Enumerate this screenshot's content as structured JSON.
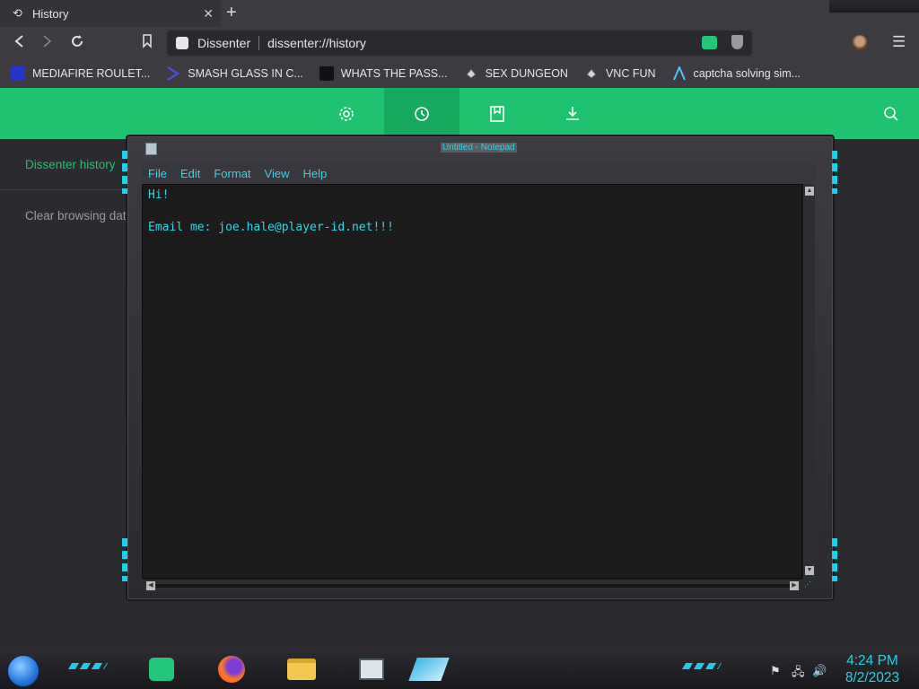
{
  "browser": {
    "tab": {
      "title": "History",
      "icon": "history-icon"
    },
    "address": {
      "site_name": "Dissenter",
      "url": "dissenter://history"
    },
    "bookmarks": [
      {
        "label": "MEDIAFIRE ROULET...",
        "icon": "mediafire-icon",
        "color": "#2336c9"
      },
      {
        "label": "SMASH GLASS IN C...",
        "icon": "chevron-icon",
        "color": "#4a4ed8"
      },
      {
        "label": "WHATS THE PASS...",
        "icon": "lock-icon",
        "color": "#111111"
      },
      {
        "label": "SEX DUNGEON",
        "icon": "pixel-icon",
        "color": "#cfcfcf"
      },
      {
        "label": "VNC FUN",
        "icon": "pixel-icon",
        "color": "#cfcfcf"
      },
      {
        "label": "captcha solving sim...",
        "icon": "a-logo-icon",
        "color": "#4fc3f7"
      }
    ]
  },
  "app": {
    "accent": "#1fc26f",
    "nav_icons": [
      "gear-icon",
      "history-icon",
      "bookmark-icon",
      "download-icon"
    ],
    "sidebar": {
      "history_label": "Dissenter history",
      "clear_label": "Clear browsing dat"
    }
  },
  "notepad": {
    "title": "Untitled - Notepad",
    "menu": [
      "File",
      "Edit",
      "Format",
      "View",
      "Help"
    ],
    "content": "Hi!\n\nEmail me: joe.hale@player-id.net!!!"
  },
  "taskbar": {
    "time": "4:24 PM",
    "date": "8/2/2023"
  }
}
